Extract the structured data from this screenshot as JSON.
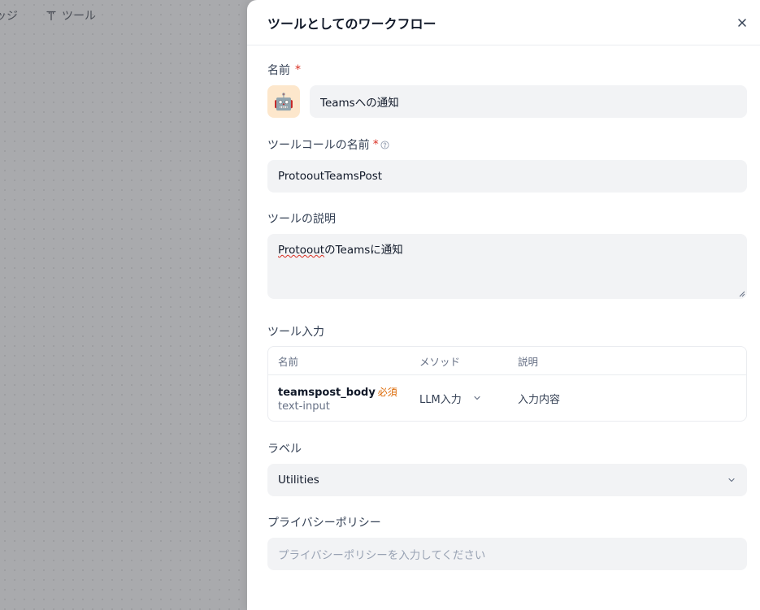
{
  "topnav": {
    "items": [
      {
        "label": "ッジ",
        "icon": "partial"
      },
      {
        "label": "ツール",
        "icon": "tool-icon"
      }
    ]
  },
  "panel": {
    "title": "ツールとしてのワークフロー",
    "name": {
      "label": "名前",
      "required_mark": "*",
      "emoji": "🤖",
      "value": "Teamsへの通知"
    },
    "tool_call_name": {
      "label": "ツールコールの名前",
      "required_mark": "*",
      "value": "ProtooutTeamsPost"
    },
    "description": {
      "label": "ツールの説明",
      "value_misspelled": "Protoout",
      "value_rest": "のTeamsに通知"
    },
    "tool_input": {
      "label": "ツール入力",
      "columns": [
        "名前",
        "メソッド",
        "説明"
      ],
      "rows": [
        {
          "name": "teamspost_body",
          "required": "必須",
          "type": "text-input",
          "method": "LLM入力",
          "description": "入力内容"
        }
      ]
    },
    "labels": {
      "label": "ラベル",
      "value": "Utilities"
    },
    "privacy": {
      "label": "プライバシーポリシー",
      "placeholder": "プライバシーポリシーを入力してください"
    }
  },
  "colors": {
    "required": "#d92d20",
    "required_badge": "#dc6803",
    "field_bg": "#f2f3f5",
    "emoji_bg": "#fde7cc"
  }
}
